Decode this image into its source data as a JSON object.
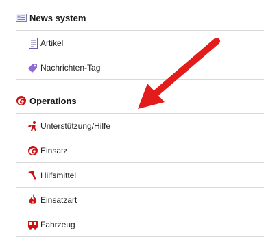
{
  "sections": [
    {
      "title": "News system",
      "icon": "newspaper-icon",
      "items": [
        {
          "label": "Artikel",
          "icon": "document-icon"
        },
        {
          "label": "Nachrichten-Tag",
          "icon": "tag-icon"
        }
      ]
    },
    {
      "title": "Operations",
      "icon": "operations-icon",
      "items": [
        {
          "label": "Unterstützung/Hilfe",
          "icon": "support-icon"
        },
        {
          "label": "Einsatz",
          "icon": "operation-icon"
        },
        {
          "label": "Hilfsmittel",
          "icon": "tool-icon"
        },
        {
          "label": "Einsatzart",
          "icon": "fire-icon"
        },
        {
          "label": "Fahrzeug",
          "icon": "vehicle-icon"
        }
      ]
    }
  ],
  "colors": {
    "accent_red": "#cc1111",
    "tag_purple": "#8e6bd1",
    "doc_purple": "#6b5ea8",
    "arrow_red": "#e31b1b",
    "border": "#d9d9d9"
  }
}
